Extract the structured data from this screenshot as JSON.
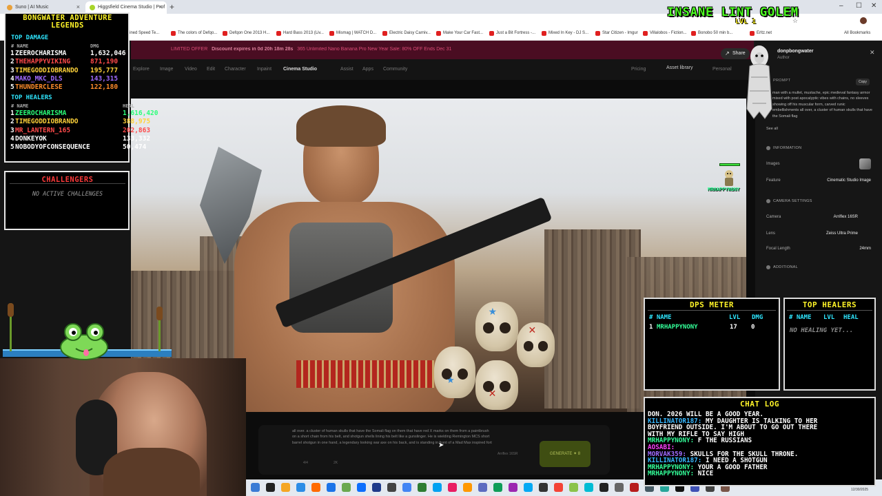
{
  "browser": {
    "tabs": [
      {
        "title": "Suno | AI Music",
        "color": "#e9a13b"
      },
      {
        "title": "Higgsfield Cinema Studio | Prof",
        "color": "#a8d52a"
      }
    ],
    "bookmarks": [
      "Combined Speed Te...",
      "The colors of Defqo...",
      "Defqon One 2013 H...",
      "Hard Bass 2013 (Liv...",
      "Mismag | WATCH D...",
      "Electric Daisy Carniv...",
      "Make Your Car Fast...",
      "Just a Bit Fortress -...",
      "Mixed In Key - DJ S...",
      "Star Citizen - Imgur",
      "Villalobos - Fiction...",
      "Bonobo 50 min b...",
      "Erltz.net"
    ],
    "all_bookmarks": "All Bookmarks",
    "window_controls": [
      "–",
      "☐",
      "✕"
    ]
  },
  "site": {
    "promo": "LIMITED OFFER",
    "promo_detail": "Discount expires in 0d 20h 18m 28s",
    "promo_offer": "365 Unlimited Nano Banana Pro New Year Sale: 80% OFF Ends Dec 31",
    "nav": [
      "Explore",
      "Image",
      "Video",
      "Edit",
      "Character",
      "Inpaint",
      "Cinema Studio",
      "Assist",
      "Apps",
      "Community"
    ],
    "nav_active": "Cinema Studio",
    "pricing": "Pricing",
    "asset_library": "Asset library",
    "personal": "Personal",
    "share": "Share",
    "prompt_preview": "all over. a cluster of human skulls that have the Somali flag on them that have red X marks on them from a paintbrush on a short chain from his belt, and shotgun shells lining his belt like a gunslinger. He is wielding Remington MCS short barrel shotgun in one hand, a legendary looking war axe on his back, and is standing in front of a Mad Max inspired fort",
    "counter_a": "4/4",
    "counter_b": "2K",
    "camera_chip": "Arriflex 16SR",
    "generate": "GENERATE ✦ 8"
  },
  "right_panel": {
    "author": "donpbongwater",
    "role": "Author",
    "prompt_label": "PROMPT",
    "copy": "Copy",
    "prompt_text": "man with a mullet, mustache, epic medieval fantasy armor mixed with post apocalyptic vibes with chains, no sleeves showing off his muscular form, carved runic embellishments all over, a cluster of human skulls that have the Somali flag",
    "see_all": "See all",
    "info_label": "INFORMATION",
    "images_key": "Images",
    "feature_key": "Feature",
    "feature_val": "Cinematic Studio Image",
    "camera_label": "CAMERA SETTINGS",
    "camera_key": "Camera",
    "camera_val": "Arriflex 16SR",
    "lens_key": "Lens",
    "lens_val": "Zeiss Ultra Prime",
    "focal_key": "Focal Length",
    "focal_val": "24mm",
    "additional_label": "ADDITIONAL"
  },
  "overlay": {
    "legends_title": "BONGWATER ADVENTURE LEGENDS",
    "top_damage": "TOP DAMAGE",
    "top_healers": "TOP HEALERS",
    "col_name": "# NAME",
    "col_dmg": "DMG",
    "col_heal": "HEAL",
    "damage_rows": [
      {
        "rank": "1",
        "name": "ZEEROCHARISMA",
        "value": "1,632,046",
        "color": "#ffffff"
      },
      {
        "rank": "2",
        "name": "THEHAPPYVIKING",
        "value": "871,190",
        "color": "#ff4a4a"
      },
      {
        "rank": "3",
        "name": "TIMEGODDIOBRANDO",
        "value": "195,777",
        "color": "#ffd23a"
      },
      {
        "rank": "4",
        "name": "MAKO_MKC_DLS",
        "value": "143,315",
        "color": "#a06bff"
      },
      {
        "rank": "5",
        "name": "THUNDERCLESE",
        "value": "122,180",
        "color": "#ff8c2a"
      }
    ],
    "healer_rows": [
      {
        "rank": "1",
        "name": "ZEEROCHARISMA",
        "value": "1,616,420",
        "color": "#2bff7a"
      },
      {
        "rank": "2",
        "name": "TIMEGODDIOBRANDO",
        "value": "388,975",
        "color": "#ffd23a"
      },
      {
        "rank": "3",
        "name": "MR_LANTERN_165",
        "value": "202,863",
        "color": "#ff4a4a"
      },
      {
        "rank": "4",
        "name": "DONKEYOK",
        "value": "133,332",
        "color": "#ffffff"
      },
      {
        "rank": "5",
        "name": "NOBODYOFCONSEQUENCE",
        "value": "50,474",
        "color": "#ffffff"
      }
    ],
    "challengers_title": "CHALLENGERS",
    "challengers_empty": "NO ACTIVE CHALLENGES",
    "boss_name": "INSANE LINT GOLEM",
    "boss_level": "LVL 1",
    "mini_player": "MRHAPPYNONY",
    "mini_hp_fraction": 1.0,
    "dps_title": "DPS METER",
    "dps_cols": {
      "name": "# NAME",
      "lvl": "LVL",
      "dmg": "DMG"
    },
    "dps_row": {
      "rank": "1",
      "name": "MRHAPPYNONY",
      "lvl": "17",
      "dmg": "0"
    },
    "heal_title": "TOP HEALERS",
    "heal_cols": {
      "name": "# NAME",
      "lvl": "LVL",
      "heal": "HEAL"
    },
    "heal_empty": "NO HEALING YET...",
    "chat_title": "CHAT LOG",
    "chat": [
      {
        "user": "",
        "msg": "DON. 2026 WILL BE A GOOD YEAR.",
        "ucolor": "#37b8ff"
      },
      {
        "user": "KILLINATOR187:",
        "msg": "MY DAUGHTER IS TALKING TO HER",
        "ucolor": "#37b8ff"
      },
      {
        "user": "",
        "msg": "BOYFRIEND OUTSIDE. I'M ABOUT TO GO OUT THERE",
        "ucolor": "#37b8ff"
      },
      {
        "user": "",
        "msg": "WITH MY RIFLE TO SAY HIGH",
        "ucolor": "#37b8ff"
      },
      {
        "user": "MRHAPPYNONY:",
        "msg": "F THE RUSSIANS",
        "ucolor": "#33ff99"
      },
      {
        "user": "AOSABI:",
        "msg": "",
        "ucolor": "#ff40ff"
      },
      {
        "user": "MORVAK359:",
        "msg": "SKULLS FOR THE SKULL THRONE.",
        "ucolor": "#a06bff"
      },
      {
        "user": "KILLINATOR187:",
        "msg": "I NEED A SHOTGUN",
        "ucolor": "#37b8ff"
      },
      {
        "user": "MRHAPPYNONY:",
        "msg": "YOUR A GOOD FATHER",
        "ucolor": "#33ff99"
      },
      {
        "user": "MRHAPPYNONY:",
        "msg": "NICE",
        "ucolor": "#33ff99"
      }
    ]
  },
  "taskbar": {
    "clock": "12/30/2025",
    "icons": [
      "#3a7bd5",
      "#222",
      "#f5a623",
      "#2c8de6",
      "#ff6a00",
      "#1b73e8",
      "#6aa84f",
      "#0d6efd",
      "#1e3a8a",
      "#444",
      "#4285f4",
      "#2e7d32",
      "#00a1f1",
      "#e91e63",
      "#ff9800",
      "#5c6bc0",
      "#0f9d58",
      "#9c27b0",
      "#03a9f4",
      "#333",
      "#f44336",
      "#8bc34a",
      "#00bcd4",
      "#222",
      "#666",
      "#b71c1c",
      "#455a64",
      "#26a69a",
      "#111",
      "#3f51b5",
      "#424242",
      "#795548"
    ]
  }
}
